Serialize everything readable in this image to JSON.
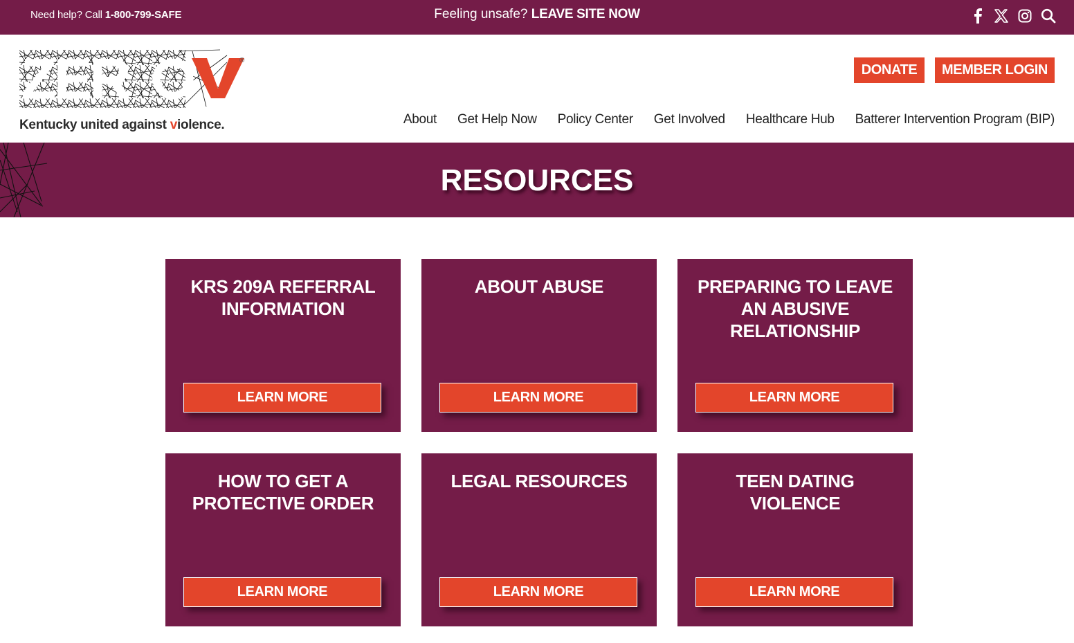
{
  "topbar": {
    "help_prefix": "Need help? Call ",
    "help_phone": "1-800-799-SAFE",
    "unsafe_prefix": "Feeling unsafe? ",
    "leave_site": "LEAVE SITE NOW",
    "icons": [
      "facebook-icon",
      "x-twitter-icon",
      "instagram-icon",
      "search-icon"
    ]
  },
  "logo": {
    "wordmark": "ZERO",
    "wordmark_accent": "V",
    "registered": "®",
    "tagline_before": "Kentucky united against ",
    "tagline_accent": "v",
    "tagline_after": "iolence."
  },
  "header": {
    "donate_label": "DONATE",
    "login_label": "MEMBER LOGIN",
    "nav": [
      {
        "label": "About"
      },
      {
        "label": "Get Help Now"
      },
      {
        "label": "Policy Center"
      },
      {
        "label": "Get Involved"
      },
      {
        "label": "Healthcare Hub"
      },
      {
        "label": "Batterer Intervention Program (BIP)"
      }
    ]
  },
  "hero": {
    "title": "RESOURCES"
  },
  "cards": [
    {
      "title": "KRS 209A REFERRAL INFORMATION",
      "button": "LEARN MORE"
    },
    {
      "title": "ABOUT ABUSE",
      "button": "LEARN MORE"
    },
    {
      "title": "PREPARING TO LEAVE AN ABUSIVE RELATIONSHIP",
      "button": "LEARN MORE"
    },
    {
      "title": "HOW TO GET A PROTECTIVE ORDER",
      "button": "LEARN MORE"
    },
    {
      "title": "LEGAL RESOURCES",
      "button": "LEARN MORE"
    },
    {
      "title": "TEEN DATING VIOLENCE",
      "button": "LEARN MORE"
    }
  ],
  "colors": {
    "brand_plum": "#741c48",
    "accent_orange": "#e3452b",
    "text_dark": "#222222"
  }
}
